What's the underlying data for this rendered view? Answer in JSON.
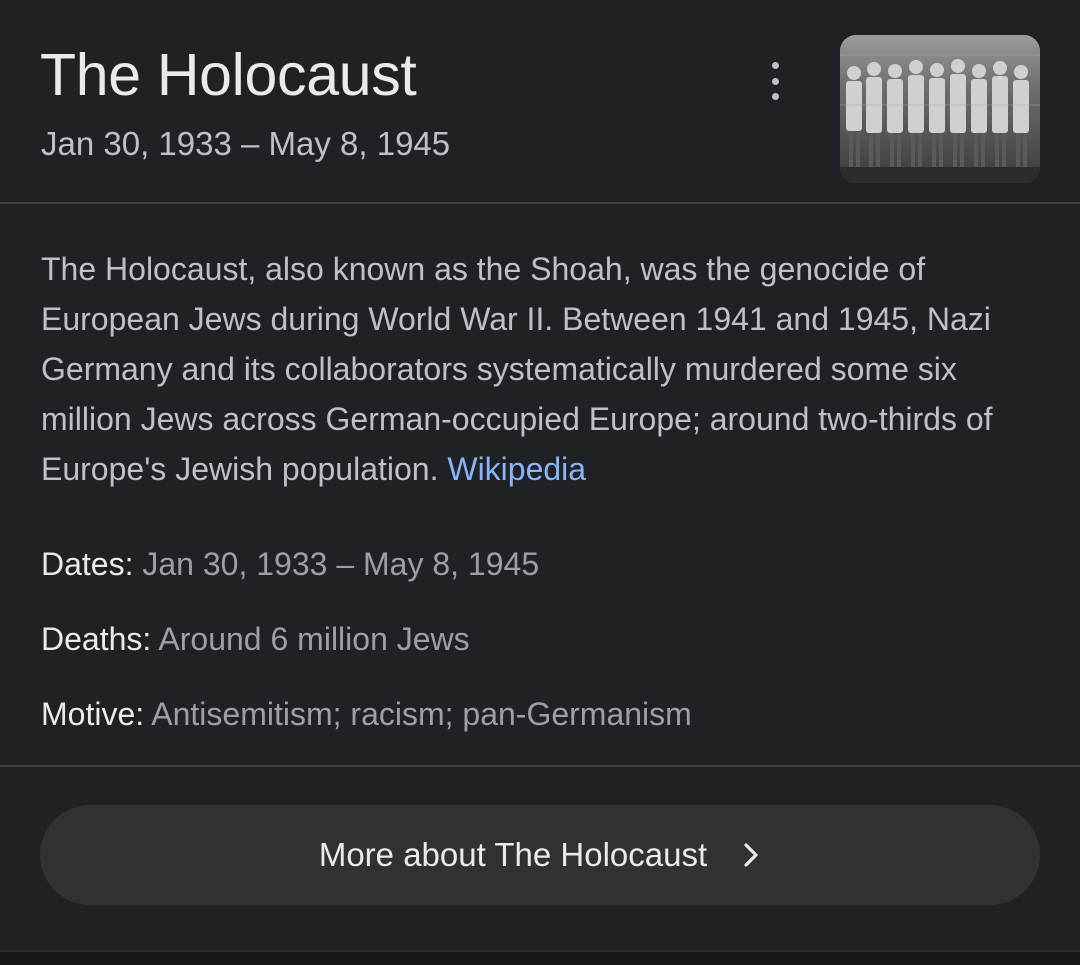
{
  "card": {
    "title": "The Holocaust",
    "subtitle": "Jan 30, 1933 – May 8, 1945",
    "more_options_icon": "three-dot-vertical-icon",
    "thumbnail_icon": "historical-photo-thumbnail"
  },
  "description": {
    "text": "The Holocaust, also known as the Shoah, was the genocide of European Jews during World War II. Between 1941 and 1945, Nazi Germany and its collaborators systematically murdered some six million Jews across German-occupied Europe; around two-thirds of Europe's Jewish population.",
    "source_link": "Wikipedia"
  },
  "facts": [
    {
      "label": "Dates:",
      "value": "Jan 30, 1933 – May 8, 1945"
    },
    {
      "label": "Deaths:",
      "value": "Around 6 million Jews"
    },
    {
      "label": "Motive:",
      "value": "Antisemitism; racism; pan-Germanism"
    }
  ],
  "more_button": {
    "label": "More about The Holocaust",
    "icon": "chevron-right-icon"
  },
  "colors": {
    "background": "#202124",
    "title": "#e8eaed",
    "body_text": "#bdc1c6",
    "muted_text": "#9aa0a6",
    "link": "#8ab4f8",
    "button_bg": "#303134",
    "divider": "#3c4043"
  }
}
